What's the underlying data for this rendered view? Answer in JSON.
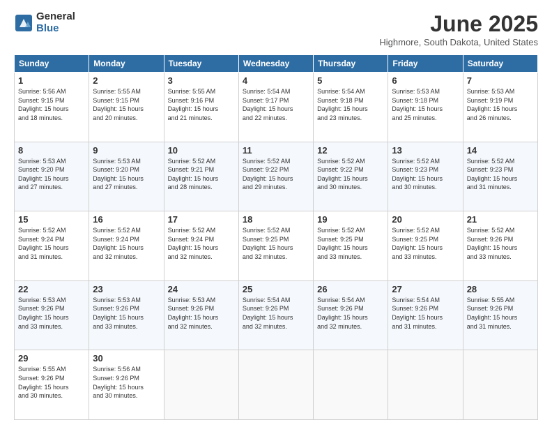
{
  "header": {
    "logo_general": "General",
    "logo_blue": "Blue",
    "month": "June 2025",
    "location": "Highmore, South Dakota, United States"
  },
  "weekdays": [
    "Sunday",
    "Monday",
    "Tuesday",
    "Wednesday",
    "Thursday",
    "Friday",
    "Saturday"
  ],
  "weeks": [
    [
      {
        "day": "1",
        "info": "Sunrise: 5:56 AM\nSunset: 9:15 PM\nDaylight: 15 hours\nand 18 minutes."
      },
      {
        "day": "2",
        "info": "Sunrise: 5:55 AM\nSunset: 9:15 PM\nDaylight: 15 hours\nand 20 minutes."
      },
      {
        "day": "3",
        "info": "Sunrise: 5:55 AM\nSunset: 9:16 PM\nDaylight: 15 hours\nand 21 minutes."
      },
      {
        "day": "4",
        "info": "Sunrise: 5:54 AM\nSunset: 9:17 PM\nDaylight: 15 hours\nand 22 minutes."
      },
      {
        "day": "5",
        "info": "Sunrise: 5:54 AM\nSunset: 9:18 PM\nDaylight: 15 hours\nand 23 minutes."
      },
      {
        "day": "6",
        "info": "Sunrise: 5:53 AM\nSunset: 9:18 PM\nDaylight: 15 hours\nand 25 minutes."
      },
      {
        "day": "7",
        "info": "Sunrise: 5:53 AM\nSunset: 9:19 PM\nDaylight: 15 hours\nand 26 minutes."
      }
    ],
    [
      {
        "day": "8",
        "info": "Sunrise: 5:53 AM\nSunset: 9:20 PM\nDaylight: 15 hours\nand 27 minutes."
      },
      {
        "day": "9",
        "info": "Sunrise: 5:53 AM\nSunset: 9:20 PM\nDaylight: 15 hours\nand 27 minutes."
      },
      {
        "day": "10",
        "info": "Sunrise: 5:52 AM\nSunset: 9:21 PM\nDaylight: 15 hours\nand 28 minutes."
      },
      {
        "day": "11",
        "info": "Sunrise: 5:52 AM\nSunset: 9:22 PM\nDaylight: 15 hours\nand 29 minutes."
      },
      {
        "day": "12",
        "info": "Sunrise: 5:52 AM\nSunset: 9:22 PM\nDaylight: 15 hours\nand 30 minutes."
      },
      {
        "day": "13",
        "info": "Sunrise: 5:52 AM\nSunset: 9:23 PM\nDaylight: 15 hours\nand 30 minutes."
      },
      {
        "day": "14",
        "info": "Sunrise: 5:52 AM\nSunset: 9:23 PM\nDaylight: 15 hours\nand 31 minutes."
      }
    ],
    [
      {
        "day": "15",
        "info": "Sunrise: 5:52 AM\nSunset: 9:24 PM\nDaylight: 15 hours\nand 31 minutes."
      },
      {
        "day": "16",
        "info": "Sunrise: 5:52 AM\nSunset: 9:24 PM\nDaylight: 15 hours\nand 32 minutes."
      },
      {
        "day": "17",
        "info": "Sunrise: 5:52 AM\nSunset: 9:24 PM\nDaylight: 15 hours\nand 32 minutes."
      },
      {
        "day": "18",
        "info": "Sunrise: 5:52 AM\nSunset: 9:25 PM\nDaylight: 15 hours\nand 32 minutes."
      },
      {
        "day": "19",
        "info": "Sunrise: 5:52 AM\nSunset: 9:25 PM\nDaylight: 15 hours\nand 33 minutes."
      },
      {
        "day": "20",
        "info": "Sunrise: 5:52 AM\nSunset: 9:25 PM\nDaylight: 15 hours\nand 33 minutes."
      },
      {
        "day": "21",
        "info": "Sunrise: 5:52 AM\nSunset: 9:26 PM\nDaylight: 15 hours\nand 33 minutes."
      }
    ],
    [
      {
        "day": "22",
        "info": "Sunrise: 5:53 AM\nSunset: 9:26 PM\nDaylight: 15 hours\nand 33 minutes."
      },
      {
        "day": "23",
        "info": "Sunrise: 5:53 AM\nSunset: 9:26 PM\nDaylight: 15 hours\nand 33 minutes."
      },
      {
        "day": "24",
        "info": "Sunrise: 5:53 AM\nSunset: 9:26 PM\nDaylight: 15 hours\nand 32 minutes."
      },
      {
        "day": "25",
        "info": "Sunrise: 5:54 AM\nSunset: 9:26 PM\nDaylight: 15 hours\nand 32 minutes."
      },
      {
        "day": "26",
        "info": "Sunrise: 5:54 AM\nSunset: 9:26 PM\nDaylight: 15 hours\nand 32 minutes."
      },
      {
        "day": "27",
        "info": "Sunrise: 5:54 AM\nSunset: 9:26 PM\nDaylight: 15 hours\nand 31 minutes."
      },
      {
        "day": "28",
        "info": "Sunrise: 5:55 AM\nSunset: 9:26 PM\nDaylight: 15 hours\nand 31 minutes."
      }
    ],
    [
      {
        "day": "29",
        "info": "Sunrise: 5:55 AM\nSunset: 9:26 PM\nDaylight: 15 hours\nand 30 minutes."
      },
      {
        "day": "30",
        "info": "Sunrise: 5:56 AM\nSunset: 9:26 PM\nDaylight: 15 hours\nand 30 minutes."
      },
      {
        "day": "",
        "info": ""
      },
      {
        "day": "",
        "info": ""
      },
      {
        "day": "",
        "info": ""
      },
      {
        "day": "",
        "info": ""
      },
      {
        "day": "",
        "info": ""
      }
    ]
  ]
}
